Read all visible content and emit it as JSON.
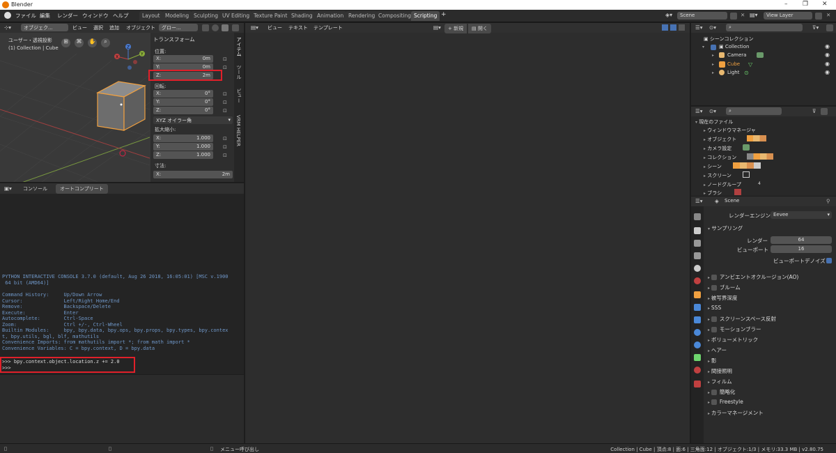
{
  "title": "Blender",
  "menu": [
    "ファイル",
    "編集",
    "レンダー",
    "ウィンドウ",
    "ヘルプ"
  ],
  "workspaces": [
    "Layout",
    "Modeling",
    "Sculpting",
    "UV Editing",
    "Texture Paint",
    "Shading",
    "Animation",
    "Rendering",
    "Compositing",
    "Scripting"
  ],
  "active_workspace": "Scripting",
  "add_tab": "+",
  "scene": {
    "name": "Scene",
    "view_layer": "View Layer"
  },
  "viewport": {
    "mode": "オブジェク...",
    "menus": [
      "ビュー",
      "選択",
      "追加",
      "オブジェクト"
    ],
    "orientation": "グロー...",
    "view_name": "ユーザー・透視投影",
    "collection_info": "(1) Collection | Cube",
    "axis_labels": {
      "x": "X",
      "y": "Y",
      "z": "Z"
    }
  },
  "nside": {
    "tabs": [
      "アイテム",
      "ツール",
      "ビュー",
      "VRM HELPER"
    ],
    "transform_title": "トランスフォーム",
    "location_label": "位置:",
    "location": [
      {
        "axis": "X:",
        "value": "0m"
      },
      {
        "axis": "Y:",
        "value": "0m"
      },
      {
        "axis": "Z:",
        "value": "2m"
      }
    ],
    "rotation_label": "回転:",
    "rotation": [
      {
        "axis": "X:",
        "value": "0°"
      },
      {
        "axis": "Y:",
        "value": "0°"
      },
      {
        "axis": "Z:",
        "value": "0°"
      }
    ],
    "rotation_mode": "XYZ オイラー角",
    "scale_label": "拡大縮小:",
    "scale": [
      {
        "axis": "X:",
        "value": "1.000"
      },
      {
        "axis": "Y:",
        "value": "1.000"
      },
      {
        "axis": "Z:",
        "value": "1.000"
      }
    ],
    "dimensions_label": "寸法:",
    "dimensions_x": {
      "axis": "X:",
      "value": "2m"
    }
  },
  "console": {
    "tabs": [
      "コンソール",
      "オートコンプリート"
    ],
    "banner": "PYTHON INTERACTIVE CONSOLE 3.7.0 (default, Aug 26 2018, 16:05:01) [MSC v.1900\n 64 bit (AMD64)]",
    "help": "Command History:     Up/Down Arrow\nCursor:              Left/Right Home/End\nRemove:              Backspace/Delete\nExecute:             Enter\nAutocomplete:        Ctrl-Space\nZoom:                Ctrl +/-, Ctrl-Wheel\nBuiltin Modules:     bpy, bpy.data, bpy.ops, bpy.props, bpy.types, bpy.contex\nt, bpy.utils, bgl, blf, mathutils\nConvenience Imports: from mathutils import *; from math import *\nConvenience Variables: C = bpy.context, D = bpy.data",
    "command": ">>> bpy.context.object.location.z += 2.0",
    "prompt": ">>> "
  },
  "text_editor": {
    "menus": [
      "ビュー",
      "テキスト",
      "テンプレート"
    ],
    "new_label": "新規",
    "open_label": "開く"
  },
  "outliner": {
    "root": "シーンコレクション",
    "collection": "Collection",
    "objects": [
      {
        "name": "Camera",
        "color": "#e8b870"
      },
      {
        "name": "Cube",
        "color": "#f0a040"
      },
      {
        "name": "Light",
        "color": "#e8b870"
      }
    ]
  },
  "blend_file": {
    "root": "現在のファイル",
    "items": [
      "ウィンドウマネージャ",
      "オブジェクト",
      "カメラ設定",
      "コレクション",
      "シーン",
      "スクリーン",
      "ノードグループ",
      "ブラシ"
    ],
    "node_group_count": "4"
  },
  "properties": {
    "scene_name": "Scene",
    "render_engine_label": "レンダーエンジン",
    "render_engine": "Eevee",
    "sampling_title": "サンプリング",
    "render_label": "レンダー",
    "render_value": "64",
    "viewport_label": "ビューポート",
    "viewport_value": "16",
    "denoise_label": "ビューポートデノイズ",
    "panels": [
      {
        "label": "アンビエントオクルージョン(AO)",
        "check": true
      },
      {
        "label": "ブルーム",
        "check": true
      },
      {
        "label": "被写界深度",
        "check": false
      },
      {
        "label": "SSS",
        "check": false
      },
      {
        "label": "スクリーンスペース反射",
        "check": true
      },
      {
        "label": "モーションブラー",
        "check": true
      },
      {
        "label": "ボリューメトリック",
        "check": false
      },
      {
        "label": "ヘアー",
        "check": false
      },
      {
        "label": "影",
        "check": false
      },
      {
        "label": "間接照明",
        "check": false
      },
      {
        "label": "フィルム",
        "check": false
      },
      {
        "label": "簡略化",
        "check": true
      },
      {
        "label": "Freestyle",
        "check": true
      },
      {
        "label": "カラーマネージメント",
        "check": false
      }
    ]
  },
  "statusbar": {
    "hint": "メニュー呼び出し",
    "stats": "Collection | Cube | 頂点:8 | 面:6 | 三角面:12 | オブジェクト:1/3 | メモリ:33.3 MB | v2.80.75"
  },
  "colors": {
    "accent": "#4772b3",
    "highlight": "#e0202a",
    "orange": "#f0a040"
  }
}
